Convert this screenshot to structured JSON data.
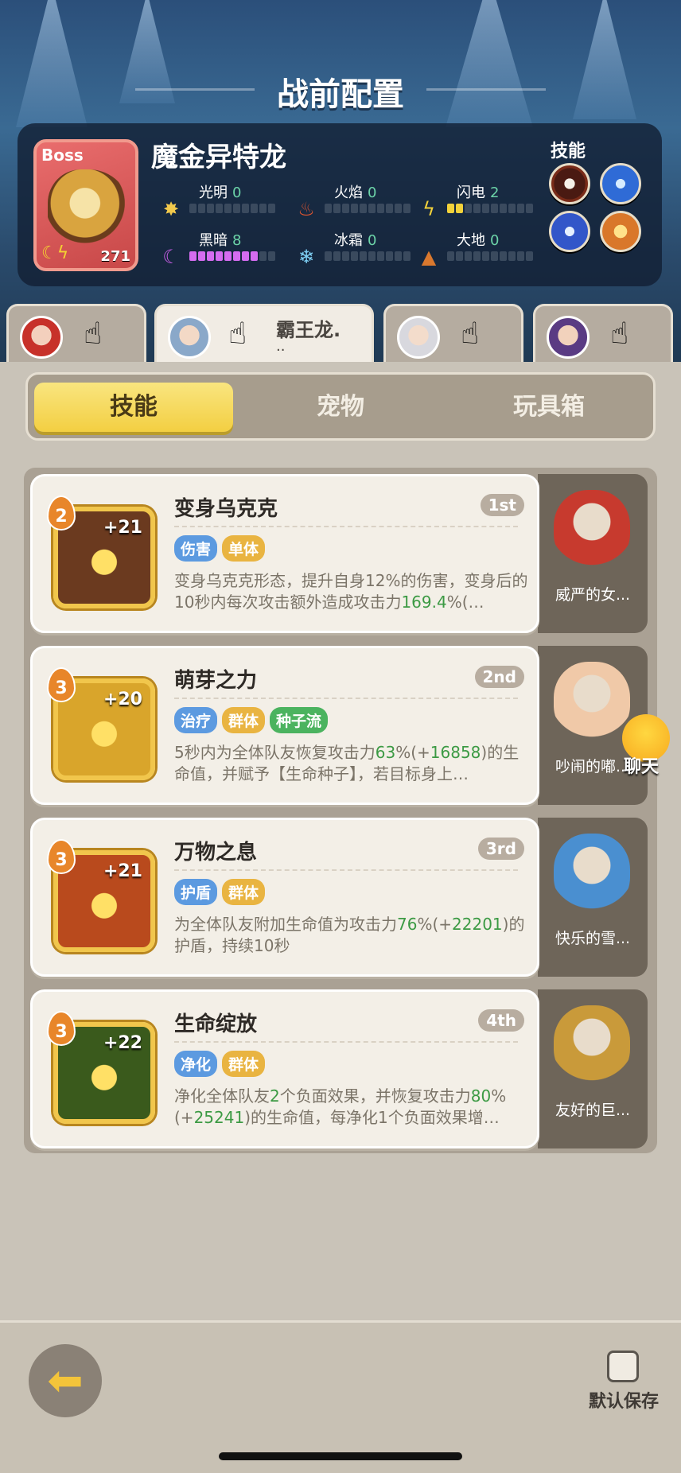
{
  "title": "战前配置",
  "boss": {
    "label": "Boss",
    "name": "魔金异特龙",
    "level": "271",
    "stats": [
      {
        "label": "光明",
        "value": "0",
        "filled": 0,
        "icon": "sun-icon",
        "glyph": "✸",
        "color": "#f2c94c"
      },
      {
        "label": "火焰",
        "value": "0",
        "filled": 0,
        "icon": "fire-icon",
        "glyph": "♨",
        "color": "#e2562f"
      },
      {
        "label": "闪电",
        "value": "2",
        "filled": 2,
        "icon": "lightning-icon",
        "glyph": "ϟ",
        "color": "#f3d23a"
      },
      {
        "label": "黑暗",
        "value": "8",
        "filled": 8,
        "icon": "moon-icon",
        "glyph": "☾",
        "color": "#c85ee6"
      },
      {
        "label": "冰霜",
        "value": "0",
        "filled": 0,
        "icon": "snowflake-icon",
        "glyph": "❄",
        "color": "#7fd0f5"
      },
      {
        "label": "大地",
        "value": "0",
        "filled": 0,
        "icon": "earth-icon",
        "glyph": "▲",
        "color": "#d9782e"
      }
    ],
    "skills_label": "技能"
  },
  "heroes": [
    {
      "name": "",
      "sub": ""
    },
    {
      "name": "霸王龙.",
      "sub": ".."
    },
    {
      "name": "",
      "sub": ""
    },
    {
      "name": "",
      "sub": ""
    }
  ],
  "segments": [
    "技能",
    "宠物",
    "玩具箱"
  ],
  "skills": [
    {
      "rank": "2",
      "bonus": "+21",
      "name": "变身乌克克",
      "order": "1st",
      "tags": [
        {
          "text": "伤害",
          "color": "blue"
        },
        {
          "text": "单体",
          "color": "gold"
        }
      ],
      "desc": [
        "变身乌克克形态，提升自身",
        "12%",
        "的伤害，变身后的10秒内每次攻击额外造成攻击力",
        "169.4",
        "%(…"
      ],
      "pet_name": "威严的女...",
      "art": "#6b3a1f"
    },
    {
      "rank": "3",
      "bonus": "+20",
      "name": "萌芽之力",
      "order": "2nd",
      "tags": [
        {
          "text": "治疗",
          "color": "blue"
        },
        {
          "text": "群体",
          "color": "gold"
        },
        {
          "text": "种子流",
          "color": "green"
        }
      ],
      "desc": [
        "5秒内为全体队友恢复攻击力",
        "63",
        "%(+",
        "16858",
        ")的生命值，并赋予【生命种子】，若目标身上…"
      ],
      "pet_name": "吵闹的嘟...",
      "art": "#d9a52b"
    },
    {
      "rank": "3",
      "bonus": "+21",
      "name": "万物之息",
      "order": "3rd",
      "tags": [
        {
          "text": "护盾",
          "color": "blue"
        },
        {
          "text": "群体",
          "color": "gold"
        }
      ],
      "desc": [
        "为全体队友附加生命值为攻击力",
        "76",
        "%(+",
        "22201",
        ")的护盾，持续10秒"
      ],
      "pet_name": "快乐的雪...",
      "art": "#b94a1d"
    },
    {
      "rank": "3",
      "bonus": "+22",
      "name": "生命绽放",
      "order": "4th",
      "tags": [
        {
          "text": "净化",
          "color": "blue"
        },
        {
          "text": "群体",
          "color": "gold"
        }
      ],
      "desc": [
        "净化全体队友",
        "2",
        "个负面效果，并恢复攻击力",
        "80",
        "%(+",
        "25241",
        ")的生命值，每净化1个负面效果增…"
      ],
      "pet_name": "友好的巨...",
      "art": "#3a5a1c"
    }
  ],
  "chat_label": "聊天",
  "save_label": "默认保存",
  "colors": {
    "accent": "#f3cf42",
    "positive": "#3c9a44",
    "dark": "#8c2fd6"
  }
}
